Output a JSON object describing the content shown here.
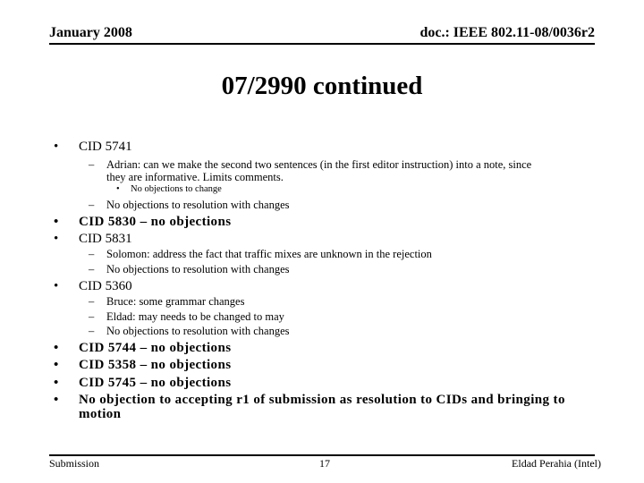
{
  "header": {
    "date": "January 2008",
    "doc_id": "doc.: IEEE 802.11-08/0036r2"
  },
  "title": "07/2990 continued",
  "bullet_glyph": "•",
  "dash_glyph": "–",
  "small_bullet_glyph": "•",
  "items": [
    {
      "text": "CID 5741",
      "subitems": [
        {
          "lines": [
            "Adrian: can we make the second two sentences (in the first editor instruction) into a note, since",
            "they are informative.  Limits comments."
          ],
          "subitems": [
            {
              "text": "No objections to change"
            }
          ]
        },
        {
          "lines": [
            "No objections to resolution with changes"
          ]
        }
      ]
    },
    {
      "text": "CID 5830 – no objections"
    },
    {
      "text": "CID 5831",
      "subitems": [
        {
          "lines": [
            "Solomon: address the fact that traffic mixes are unknown in the rejection"
          ]
        },
        {
          "lines": [
            "No objections to resolution with changes"
          ]
        }
      ]
    },
    {
      "text": "CID 5360",
      "subitems": [
        {
          "lines": [
            "Bruce: some grammar changes"
          ]
        },
        {
          "lines": [
            "Eldad: may needs to be changed to may"
          ]
        },
        {
          "lines": [
            "No objections to resolution with changes"
          ]
        }
      ]
    },
    {
      "text": "CID 5744 – no objections"
    },
    {
      "text": "CID 5358 – no objections"
    },
    {
      "text": "CID 5745 – no objections"
    },
    {
      "lines": [
        "No objection to accepting r1 of submission as resolution to CIDs and bringing to",
        "motion"
      ]
    }
  ],
  "footer": {
    "left": "Submission",
    "page_number": "17",
    "author": "Eldad Perahia (Intel)"
  }
}
